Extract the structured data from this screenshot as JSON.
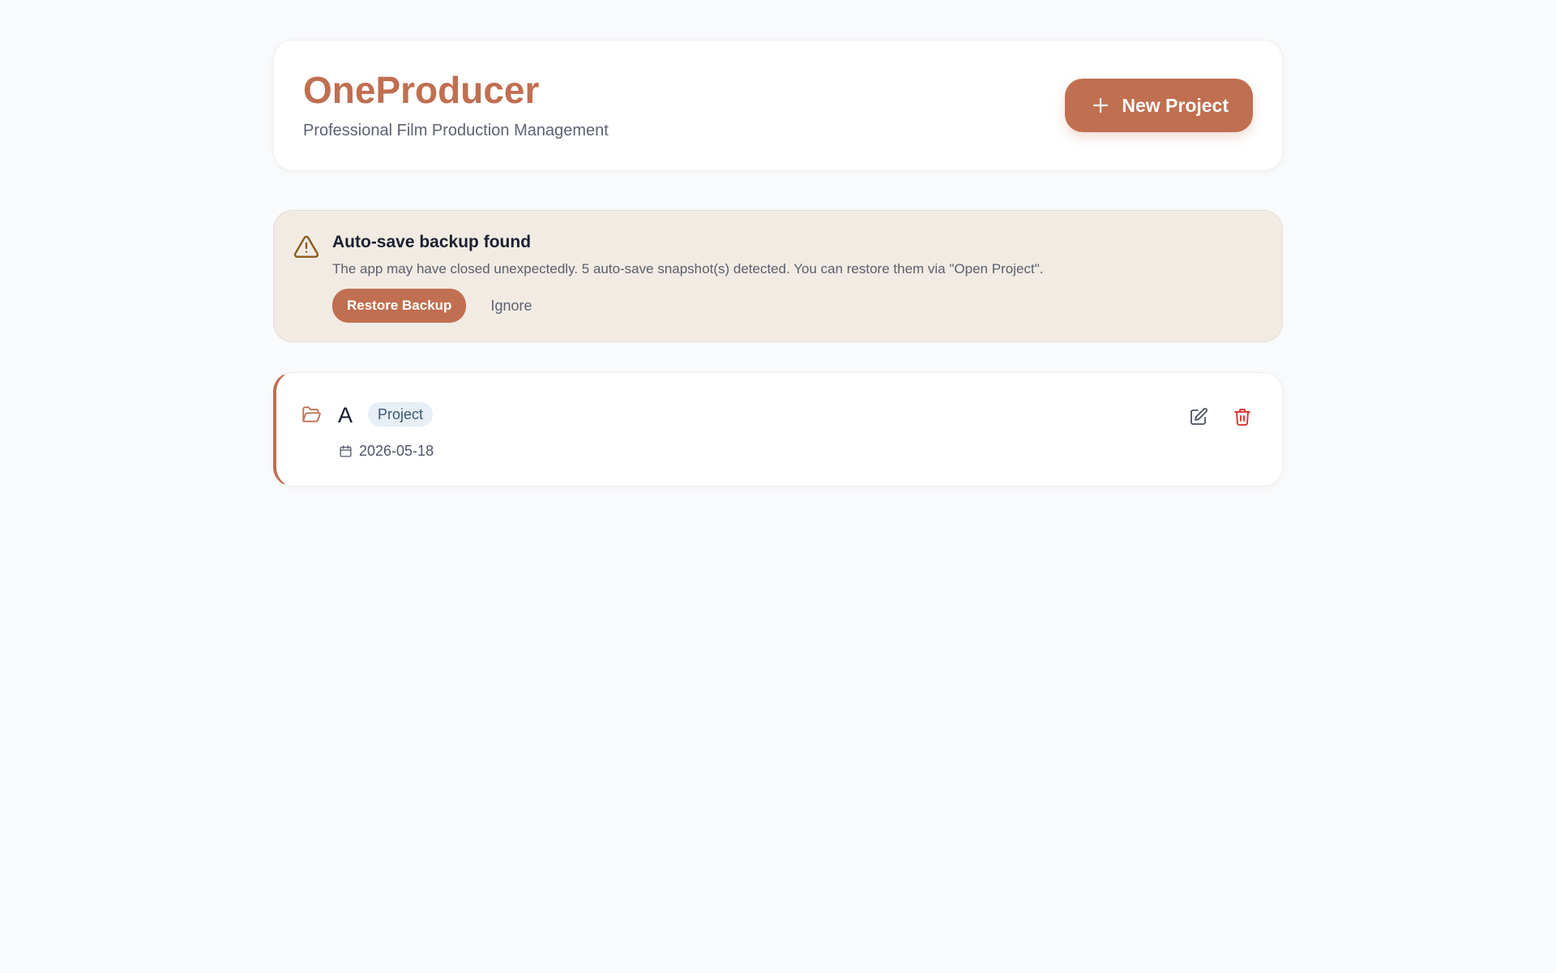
{
  "header": {
    "title": "OneProducer",
    "subtitle": "Professional Film Production Management",
    "new_project_label": "New Project"
  },
  "alert": {
    "title": "Auto-save backup found",
    "message": "The app may have closed unexpectedly. 5 auto-save snapshot(s) detected. You can restore them via \"Open Project\".",
    "restore_label": "Restore Backup",
    "ignore_label": "Ignore"
  },
  "projects": [
    {
      "name": "A",
      "badge": "Project",
      "date": "2026-05-18"
    }
  ],
  "icons": {
    "new_project": "plus-icon",
    "alert": "warning-triangle-icon",
    "project": "folder-open-icon",
    "date": "calendar-icon",
    "edit": "edit-icon",
    "delete": "trash-icon"
  },
  "colors": {
    "accent": "#c06f50",
    "alert_bg": "#f1ebe4",
    "warning": "#8a5a1a",
    "danger": "#dc2626",
    "badge_bg": "#e7eef5"
  }
}
